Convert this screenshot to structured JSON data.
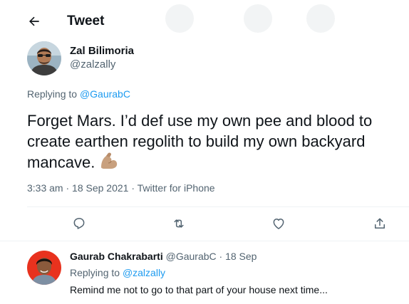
{
  "header": {
    "title": "Tweet",
    "back_icon": "arrow-left-icon"
  },
  "tweet": {
    "author_name": "Zal Bilimoria",
    "author_handle": "@zalzally",
    "replying_prefix": "Replying to",
    "replying_to": "@GaurabC",
    "text": "Forget Mars. I’d def use my own pee and blood to create earthen regolith to build my own backyard mancave.",
    "emoji": "flexed-biceps-icon",
    "timestamp": "3:33 am · 18 Sep 2021 · Twitter for iPhone"
  },
  "actions": [
    {
      "icon": "reply-icon"
    },
    {
      "icon": "retweet-icon"
    },
    {
      "icon": "like-icon"
    },
    {
      "icon": "share-icon"
    }
  ],
  "reply": {
    "author_name": "Gaurab Chakrabarti",
    "author_handle": "@GaurabC",
    "separator": "·",
    "date": "18 Sep",
    "replying_prefix": "Replying to",
    "replying_to": "@zalzally",
    "text": "Remind me not to go to that part of your house next time..."
  },
  "colors": {
    "link": "#1d9bf0",
    "secondary_text": "#536471",
    "primary_text": "#0f1419",
    "divider": "#eff3f4"
  }
}
